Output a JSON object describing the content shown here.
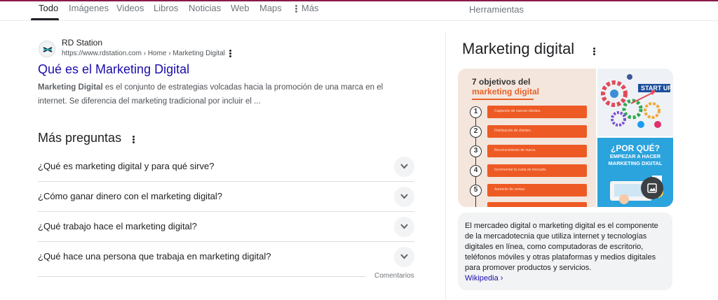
{
  "tabs": [
    {
      "label": "Todo"
    },
    {
      "label": "Imágenes"
    },
    {
      "label": "Videos"
    },
    {
      "label": "Libros"
    },
    {
      "label": "Noticias"
    },
    {
      "label": "Web"
    },
    {
      "label": "Maps"
    },
    {
      "label": "Más"
    }
  ],
  "tools_label": "Herramientas",
  "colors": {
    "accent_line": "#8a1a4a",
    "link": "#1a0dab",
    "orange": "#ee5a24"
  },
  "result": {
    "favicon": "rd-station-logo",
    "site_name": "RD Station",
    "url": "https://www.rdstation.com › Home › Marketing Digital",
    "title": "Qué es el Marketing Digital",
    "snippet_bold": "Marketing Digital",
    "snippet_rest": " es el conjunto de estrategias volcadas hacia la promoción de una marca en el internet. Se diferencia del marketing tradicional por incluir el ..."
  },
  "paa": {
    "title": "Más preguntas",
    "questions": [
      "¿Qué es marketing digital y para qué sirve?",
      "¿Cómo ganar dinero con el marketing digital?",
      "¿Qué trabajo hace el marketing digital?",
      "¿Qué hace una persona que trabaja en marketing digital?"
    ],
    "comments_label": "Comentarios"
  },
  "knowledge_panel": {
    "title": "Marketing digital",
    "main_image": {
      "heading_line1": "7 objetivos del",
      "heading_line2": "marketing digital",
      "items": [
        {
          "num": "1",
          "text": "Captación de nuevos clientes."
        },
        {
          "num": "2",
          "text": "Fidelización de clientes."
        },
        {
          "num": "3",
          "text": "Reconocimiento de marca."
        },
        {
          "num": "4",
          "text": "Incrementar la cuota de mercado."
        },
        {
          "num": "5",
          "text": "Aumento de ventas."
        }
      ]
    },
    "side_image_top": {
      "label": "START UP"
    },
    "side_image_bottom": {
      "line1": "¿POR QUÉ?",
      "line2": "EMPEZAR A HACER",
      "line3": "MARKETING DIGITAL"
    },
    "description": "El mercadeo digital o marketing digital es el componente de la mercadotecnia que utiliza internet y tecnologías digitales en línea, como computadoras de escritorio, teléfonos móviles y otras plataformas y medios digitales para promover productos y servicios.",
    "source_link": "Wikipedia ›"
  }
}
